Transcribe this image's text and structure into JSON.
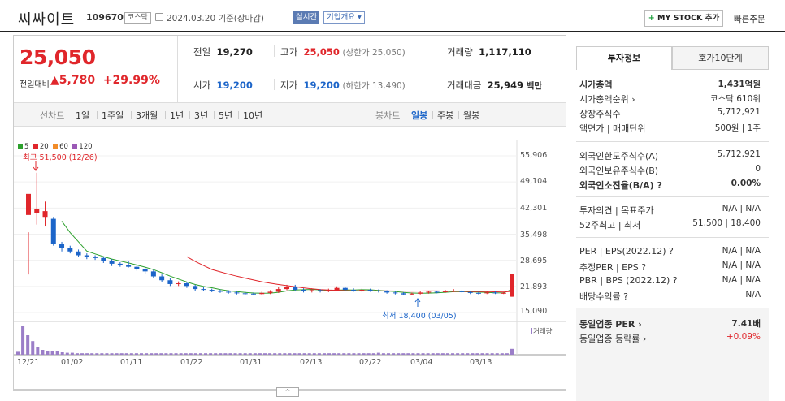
{
  "header": {
    "company": "씨싸이트",
    "code": "109670",
    "market_tag": "코스닥",
    "date_text": "2024.03.20  기준(장마감)",
    "realtime_label": "실시간",
    "company_info_label": "기업개요 ▾",
    "my_stock_label": "MY STOCK 추가",
    "my_stock_plus": "+",
    "quick_order_label": "빠른주문"
  },
  "quote": {
    "price": "25,050",
    "change_label": "전일대비",
    "change_arrow": "▲",
    "change_amount": "5,780",
    "change_pct": "+29.99%",
    "prev_label": "전일",
    "prev": "19,270",
    "high_label": "고가",
    "high": "25,050",
    "high_sub": "(상한가 25,050)",
    "volume_label": "거래량",
    "volume": "1,117,110",
    "open_label": "시가",
    "open": "19,200",
    "low_label": "저가",
    "low": "19,200",
    "low_sub": "(하한가 13,490)",
    "amount_label": "거래대금",
    "amount": "25,949",
    "amount_unit": "백만"
  },
  "periods": {
    "line_label": "선차트",
    "line": [
      "1일",
      "1주일",
      "3개월",
      "1년",
      "3년",
      "5년",
      "10년"
    ],
    "candle_label": "봉차트",
    "candle": [
      "일봉",
      "주봉",
      "월봉"
    ],
    "selected": "일봉"
  },
  "chart_data": {
    "type": "candlestick",
    "legend": [
      {
        "name": "5",
        "color": "#2ca02c"
      },
      {
        "name": "20",
        "color": "#e0262b"
      },
      {
        "name": "60",
        "color": "#f28c28"
      },
      {
        "name": "120",
        "color": "#9b59b6"
      }
    ],
    "y_ticks": [
      "55,906",
      "49,104",
      "42,301",
      "35,498",
      "28,695",
      "21,893",
      "15,090"
    ],
    "ylim": [
      15090,
      55906
    ],
    "x_labels": [
      "12/21",
      "01/02",
      "01/11",
      "01/22",
      "01/31",
      "02/13",
      "02/22",
      "03/04",
      "03/13"
    ],
    "high_annotation": "최고 51,500 (12/26)",
    "low_annotation": "최저 18,400 (03/05)",
    "volume_label": "거래량",
    "candles": [
      [
        40500,
        46000,
        36000,
        25000
      ],
      [
        41000,
        42000,
        51500,
        38000
      ],
      [
        40000,
        41500,
        44000,
        37500
      ],
      [
        39500,
        33000,
        40000,
        32500
      ],
      [
        33000,
        32000,
        33500,
        31000
      ],
      [
        32000,
        31000,
        32500,
        30500
      ],
      [
        31000,
        30000,
        31500,
        29500
      ],
      [
        30000,
        29500,
        30500,
        29000
      ],
      [
        29500,
        29300,
        30000,
        28800
      ],
      [
        29300,
        28500,
        29500,
        28000
      ],
      [
        28500,
        27800,
        29000,
        27200
      ],
      [
        27800,
        27500,
        28200,
        27000
      ],
      [
        27500,
        27000,
        28500,
        26800
      ],
      [
        27000,
        26500,
        27500,
        26000
      ],
      [
        26500,
        25800,
        27000,
        25200
      ],
      [
        25800,
        24500,
        26200,
        24000
      ],
      [
        24500,
        23500,
        25000,
        23000
      ],
      [
        23500,
        22500,
        24000,
        22000
      ],
      [
        22500,
        22700,
        23200,
        22000
      ],
      [
        22700,
        22000,
        23000,
        21500
      ],
      [
        22000,
        21200,
        22300,
        20800
      ],
      [
        21200,
        21000,
        21800,
        20600
      ],
      [
        21000,
        20800,
        21300,
        20400
      ],
      [
        20800,
        20500,
        21100,
        20200
      ],
      [
        20500,
        20300,
        20900,
        20000
      ],
      [
        20300,
        20100,
        20700,
        19800
      ],
      [
        20100,
        20000,
        20500,
        19700
      ],
      [
        20000,
        19900,
        20300,
        19600
      ],
      [
        19900,
        20200,
        20500,
        19700
      ],
      [
        20200,
        20500,
        20900,
        19900
      ],
      [
        20500,
        21200,
        21800,
        20200
      ],
      [
        21200,
        21800,
        22300,
        20900
      ],
      [
        21800,
        21000,
        22300,
        20700
      ],
      [
        21000,
        20700,
        21400,
        20300
      ],
      [
        20700,
        20900,
        21400,
        20300
      ],
      [
        20900,
        20600,
        21200,
        20300
      ],
      [
        20600,
        20900,
        21300,
        20400
      ],
      [
        20900,
        21500,
        21900,
        20600
      ],
      [
        21500,
        21000,
        21800,
        20700
      ],
      [
        21000,
        20800,
        21400,
        20500
      ],
      [
        20800,
        21000,
        21300,
        20500
      ],
      [
        21000,
        20800,
        21300,
        20500
      ],
      [
        20800,
        20600,
        21100,
        20300
      ],
      [
        20600,
        20300,
        20900,
        20000
      ],
      [
        20300,
        20100,
        20600,
        19800
      ],
      [
        20100,
        19800,
        20400,
        19600
      ],
      [
        19800,
        20000,
        20300,
        19600
      ],
      [
        20000,
        20300,
        20600,
        19800
      ],
      [
        20300,
        20500,
        20800,
        20000
      ],
      [
        20500,
        20400,
        20800,
        20100
      ],
      [
        20400,
        20600,
        21000,
        20200
      ],
      [
        20600,
        20700,
        21200,
        20400
      ],
      [
        20700,
        20400,
        21000,
        20200
      ],
      [
        20400,
        20200,
        20700,
        19900
      ],
      [
        20200,
        20100,
        20500,
        19800
      ],
      [
        20100,
        20300,
        20600,
        19900
      ],
      [
        20300,
        20100,
        20600,
        19900
      ],
      [
        20100,
        20200,
        20500,
        19900
      ],
      [
        19200,
        25050,
        25050,
        19200
      ]
    ],
    "volume": [
      6,
      60,
      40,
      28,
      15,
      10,
      8,
      7,
      8,
      5,
      4,
      4,
      3,
      3,
      3,
      3,
      3,
      3,
      3,
      3,
      3,
      3,
      3,
      3,
      3,
      3,
      3,
      3,
      3,
      3,
      3,
      3,
      3,
      3,
      3,
      3,
      3,
      3,
      3,
      3,
      3,
      3,
      3,
      3,
      3,
      3,
      3,
      3,
      3,
      3,
      3,
      3,
      3,
      3,
      3,
      3,
      3,
      3,
      3,
      3,
      3,
      3,
      3,
      3,
      3,
      3,
      3,
      3,
      3,
      3,
      3,
      3,
      3,
      4,
      3,
      3,
      3,
      3,
      3,
      3,
      3,
      3,
      3,
      3,
      3,
      3,
      3,
      3,
      3,
      3,
      3,
      3,
      3,
      3,
      3,
      3,
      3,
      3,
      3,
      3,
      12
    ]
  },
  "invest": {
    "tab_info": "투자정보",
    "tab_order": "호가10단계",
    "rows1": [
      {
        "label": "시가총액",
        "value": "1,431억원",
        "bold": true
      },
      {
        "label": "시가총액순위 ›",
        "value": "코스닥 610위"
      },
      {
        "label": "상장주식수",
        "value": "5,712,921"
      },
      {
        "label": "액면가 | 매매단위",
        "value": "500원 | 1주"
      }
    ],
    "rows2": [
      {
        "label": "외국인한도주식수(A)",
        "value": "5,712,921"
      },
      {
        "label": "외국인보유주식수(B)",
        "value": "0"
      },
      {
        "label": "외국인소진율(B/A) ?",
        "value": "0.00%",
        "bold": true
      }
    ],
    "rows3": [
      {
        "label": "투자의견 | 목표주가",
        "value": "N/A | N/A"
      },
      {
        "label": "52주최고 | 최저",
        "value": "51,500 | 18,400"
      }
    ],
    "rows4": [
      {
        "label": "PER | EPS(2022.12) ?",
        "value": "N/A | N/A"
      },
      {
        "label": "추정PER | EPS ?",
        "value": "N/A | N/A"
      },
      {
        "label": "PBR | BPS (2022.12) ?",
        "value": "N/A | N/A"
      },
      {
        "label": "배당수익률 ?",
        "value": "N/A"
      }
    ],
    "rows5": [
      {
        "label": "동일업종 PER ›",
        "value": "7.41배",
        "bold": true
      },
      {
        "label": "동일업종 등락률 ›",
        "value": "+0.09%",
        "red": true
      }
    ]
  },
  "collapse_icon": "^"
}
